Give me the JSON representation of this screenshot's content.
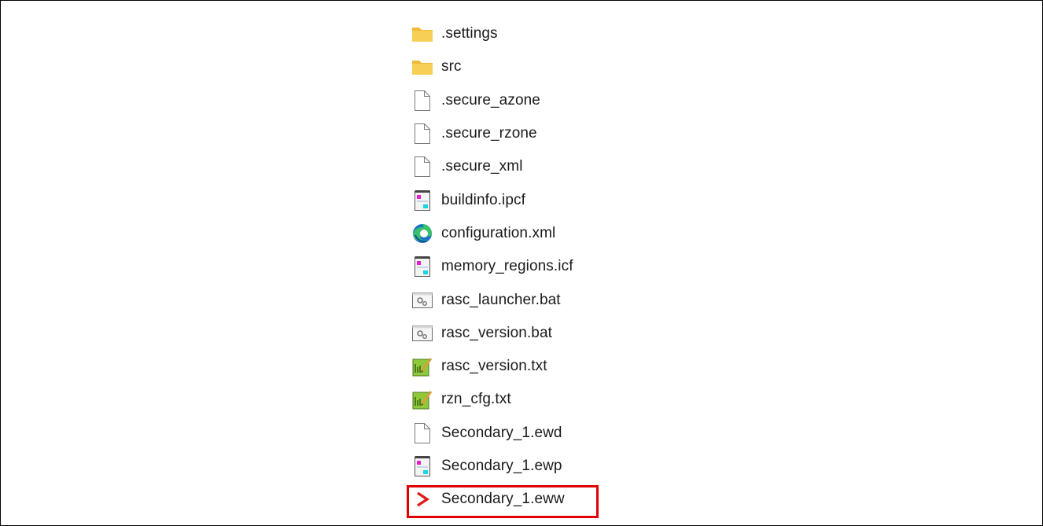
{
  "files": [
    {
      "name": ".settings",
      "icon": "folder-icon"
    },
    {
      "name": "src",
      "icon": "folder-icon"
    },
    {
      "name": ".secure_azone",
      "icon": "blank-file-icon"
    },
    {
      "name": ".secure_rzone",
      "icon": "blank-file-icon"
    },
    {
      "name": ".secure_xml",
      "icon": "blank-file-icon"
    },
    {
      "name": "buildinfo.ipcf",
      "icon": "notepad-file-icon"
    },
    {
      "name": "configuration.xml",
      "icon": "edge-browser-icon"
    },
    {
      "name": "memory_regions.icf",
      "icon": "notepad-file-icon"
    },
    {
      "name": "rasc_launcher.bat",
      "icon": "batch-file-icon"
    },
    {
      "name": "rasc_version.bat",
      "icon": "batch-file-icon"
    },
    {
      "name": "rasc_version.txt",
      "icon": "text-editor-icon"
    },
    {
      "name": "rzn_cfg.txt",
      "icon": "text-editor-icon"
    },
    {
      "name": "Secondary_1.ewd",
      "icon": "blank-file-icon"
    },
    {
      "name": "Secondary_1.ewp",
      "icon": "notepad-file-icon"
    },
    {
      "name": "Secondary_1.eww",
      "icon": "iar-workspace-icon"
    }
  ],
  "highlighted_file": "Secondary_1.eww",
  "colors": {
    "highlight": "#e00000",
    "folder": "#f6c744",
    "text": "#1a1a1a"
  }
}
